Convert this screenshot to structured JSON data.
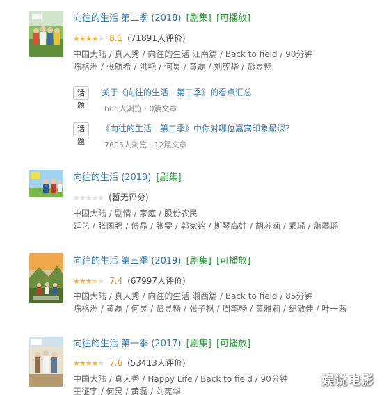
{
  "entries": [
    {
      "title": "向往的生活 第二季 (2018)",
      "tags": [
        "[剧集]",
        "[可播放]"
      ],
      "stars": "4.0",
      "score": "8.1",
      "votes": "(71891人评价)",
      "meta": "中国大陆 / 真人秀 / 向往的生活 江南篇 / Back to field / 90分钟",
      "cast": "陈格洲 / 张航希 / 洪艳 / 何炅 / 黄磊 / 刘宪华 / 彭昱畅",
      "topics": [
        {
          "button": "话题",
          "title": "关于《向往的生活　第二季》的看点汇总",
          "stats": "665人浏览 · 0篇文章"
        },
        {
          "button": "话题",
          "title": "《向往的生活　第二季》中你对哪位嘉宾印象最深？",
          "stats": "7605人浏览 · 12篇文章"
        }
      ]
    },
    {
      "title": "向往的生活 (2019)",
      "tags": [
        "[剧集]"
      ],
      "stars": "0",
      "score": "",
      "votes": "(暂无评分)",
      "meta": "中国大陆 / 剧情 / 家庭 / 股份农民",
      "cast": "延艺 / 张国强 / 傅晶 / 张雯 / 郭家铭 / 斯琴高娃 / 胡苏涵 / 乘瑶 / 萧馨瑶"
    },
    {
      "title": "向往的生活 第三季 (2019)",
      "tags": [
        "[剧集]",
        "[可播放]"
      ],
      "stars": "3.5",
      "score": "7.4",
      "votes": "(67997人评价)",
      "meta": "中国大陆 / 真人秀 / 向往的生活 湘西篇 / Back to field / 85分钟",
      "cast": "陈格洲 / 黄磊 / 何炅 / 彭昱畅 / 张子枫 / 周笔畅 / 黄雅莉 / 纪敏佳 / 叶一茜"
    },
    {
      "title": "向往的生活 第一季 (2017)",
      "tags": [
        "[剧集]",
        "[可播放]"
      ],
      "stars": "4.0",
      "score": "7.6",
      "votes": "(53413人评价)",
      "meta": "中国大陆 / 真人秀 / Happy Life / Back to field / 90分钟",
      "cast": "王征宇 / 何炅 / 黄磊 / 刘宪华"
    }
  ],
  "watermark": "娱说电影",
  "colors": {
    "link": "#3377aa",
    "tag": "#2c9a3c",
    "star": "#ffac2d",
    "score": "#e09015",
    "meta": "#666666"
  }
}
